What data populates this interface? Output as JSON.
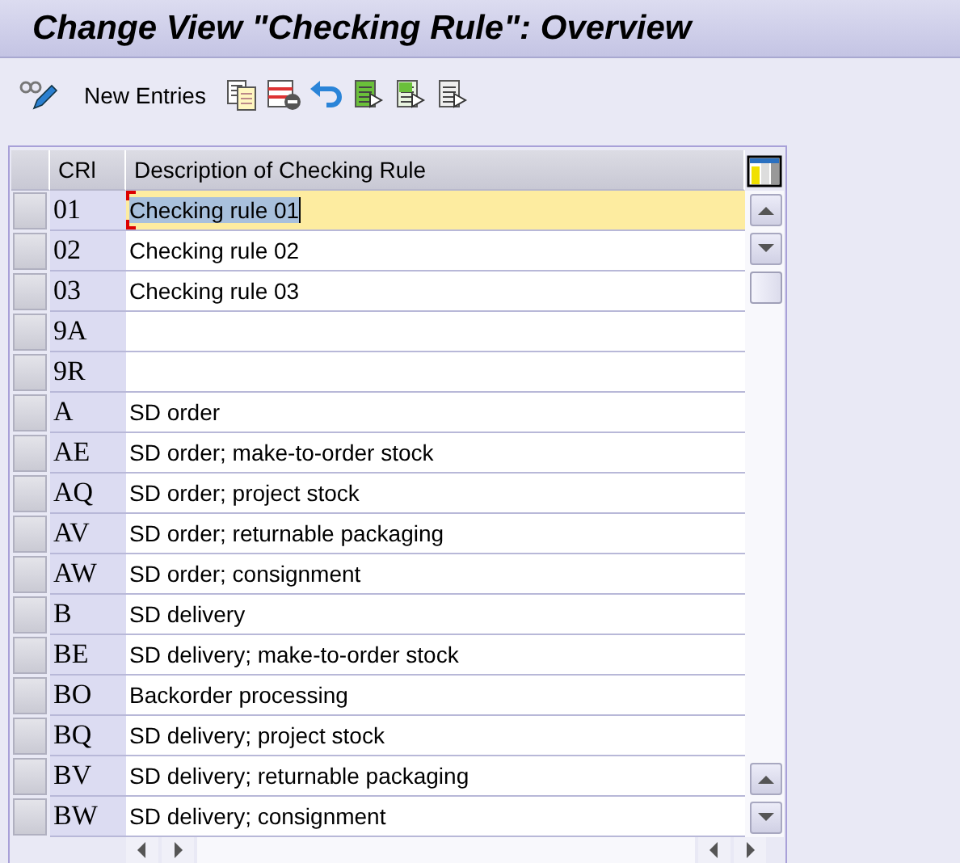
{
  "title": "Change View \"Checking Rule\": Overview",
  "toolbar": {
    "new_entries": "New Entries"
  },
  "table": {
    "columns": [
      "CRl",
      "Description of Checking Rule"
    ],
    "rows": [
      {
        "code": "01",
        "description": "Checking rule 01",
        "selected": true
      },
      {
        "code": "02",
        "description": "Checking rule 02",
        "selected": false
      },
      {
        "code": "03",
        "description": "Checking rule 03",
        "selected": false
      },
      {
        "code": "9A",
        "selected": false
      },
      {
        "code": "9R",
        "selected": false
      },
      {
        "code": "A",
        "description": "SD order",
        "selected": false
      },
      {
        "code": "AE",
        "description": "SD order; make-to-order stock",
        "selected": false
      },
      {
        "code": "AQ",
        "description": "SD order; project stock",
        "selected": false
      },
      {
        "code": "AV",
        "description": "SD order; returnable packaging",
        "selected": false
      },
      {
        "code": "AW",
        "description": "SD order; consignment",
        "selected": false
      },
      {
        "code": "B",
        "description": "SD delivery",
        "selected": false
      },
      {
        "code": "BE",
        "description": "SD delivery; make-to-order stock",
        "selected": false
      },
      {
        "code": "BO",
        "description": "Backorder processing",
        "selected": false
      },
      {
        "code": "BQ",
        "description": "SD delivery; project stock",
        "selected": false
      },
      {
        "code": "BV",
        "description": "SD delivery; returnable packaging",
        "selected": false
      },
      {
        "code": "BW",
        "description": "SD delivery; consignment",
        "selected": false
      }
    ]
  }
}
